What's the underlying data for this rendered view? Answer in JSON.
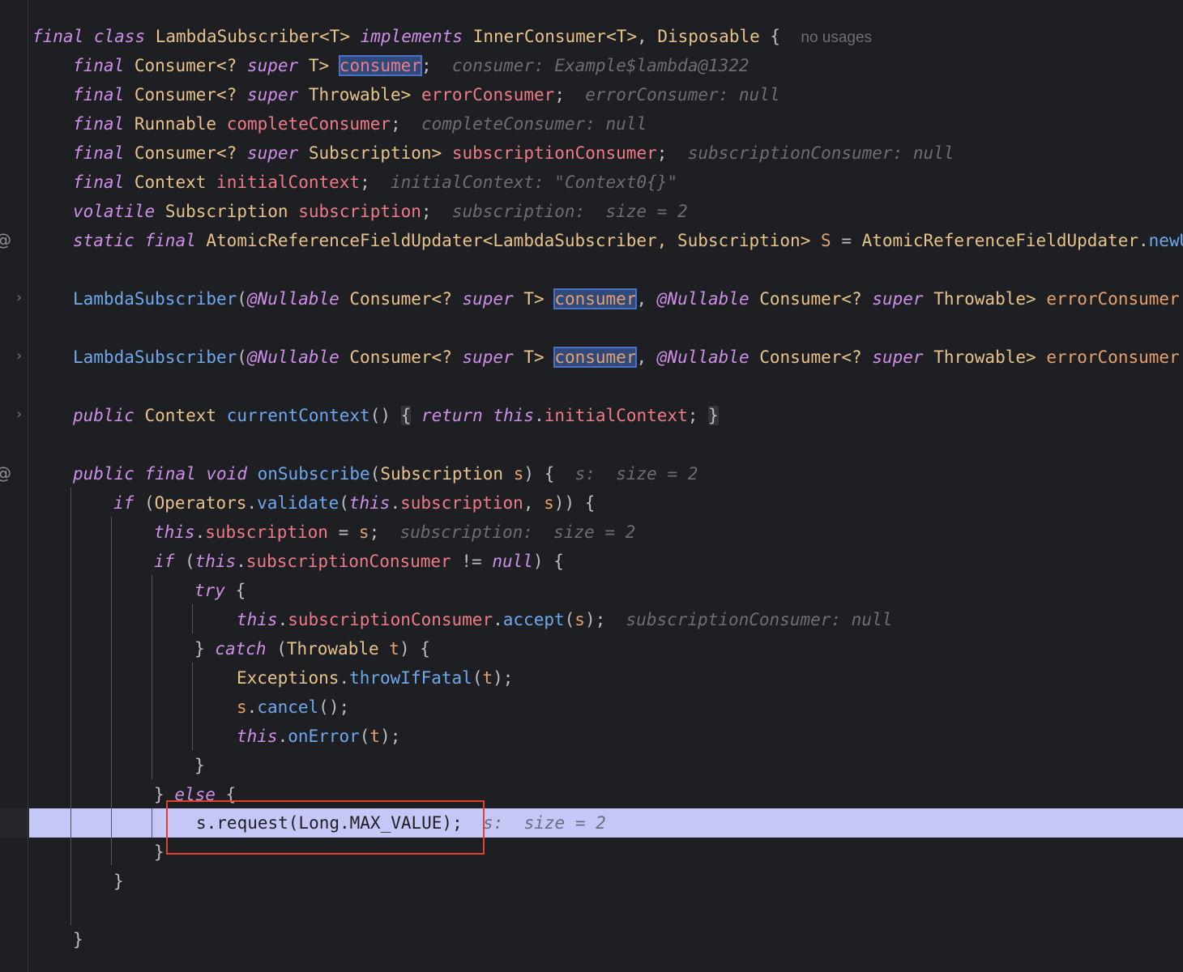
{
  "gutter": {
    "override_marker": "@",
    "fold_marker": "›"
  },
  "code": {
    "l01": {
      "kw_final": "final",
      "kw_class": "class",
      "class_name": "LambdaSubscriber<T>",
      "kw_implements": "implements",
      "iface1": "InnerConsumer<T>",
      "comma": ",",
      "iface2": "Disposable",
      "brace": "{",
      "hint": "no usages"
    },
    "l02": {
      "kw_final": "final",
      "t1": "Consumer<?",
      "kw_super": "super",
      "t2": "T>",
      "field": "consumer",
      "semi": ";",
      "hint": "consumer: Example$lambda@1322"
    },
    "l03": {
      "kw_final": "final",
      "t1": "Consumer<?",
      "kw_super": "super",
      "t2": "Throwable>",
      "field": "errorConsumer",
      "semi": ";",
      "hint": "errorConsumer: null"
    },
    "l04": {
      "kw_final": "final",
      "t1": "Runnable",
      "field": "completeConsumer",
      "semi": ";",
      "hint": "completeConsumer: null"
    },
    "l05": {
      "kw_final": "final",
      "t1": "Consumer<?",
      "kw_super": "super",
      "t2": "Subscription>",
      "field": "subscriptionConsumer",
      "semi": ";",
      "hint": "subscriptionConsumer: null"
    },
    "l06": {
      "kw_final": "final",
      "t1": "Context",
      "field": "initialContext",
      "semi": ";",
      "hint": "initialContext: \"Context0{}\""
    },
    "l07": {
      "kw_volatile": "volatile",
      "t1": "Subscription",
      "field": "subscription",
      "semi": ";",
      "hint": "subscription:  size = 2"
    },
    "l08": {
      "kw_static": "static",
      "kw_final": "final",
      "t1": "AtomicReferenceFieldUpdater<LambdaSubscriber, Subscription>",
      "field": "S",
      "eq": "=",
      "t2": "AtomicReferenceFieldUpdater",
      "dot": ".",
      "fn": "newU"
    },
    "l09": {
      "ctor": "LambdaSubscriber",
      "open": "(",
      "ann1": "@Nullable",
      "t1": "Consumer<?",
      "kw_super": "super",
      "t2": "T>",
      "param1": "consumer",
      "comma": ",",
      "ann2": "@Nullable",
      "t3": "Consumer<?",
      "kw_super2": "super",
      "t4": "Throwable>",
      "param2": "errorConsumer",
      "comma2": ","
    },
    "l10": {
      "ctor": "LambdaSubscriber",
      "open": "(",
      "ann1": "@Nullable",
      "t1": "Consumer<?",
      "kw_super": "super",
      "t2": "T>",
      "param1": "consumer",
      "comma": ",",
      "ann2": "@Nullable",
      "t3": "Consumer<?",
      "kw_super2": "super",
      "t4": "Throwable>",
      "param2": "errorConsumer",
      "comma2": ","
    },
    "l11": {
      "kw_public": "public",
      "t1": "Context",
      "fn": "currentContext",
      "parens": "()",
      "brace_open": "{",
      "kw_return": "return",
      "kw_this": "this",
      "dot": ".",
      "field": "initialContext",
      "semi": ";",
      "brace_close": "}"
    },
    "l12": {
      "kw_public": "public",
      "kw_final": "final",
      "kw_void": "void",
      "fn": "onSubscribe",
      "open": "(",
      "t1": "Subscription",
      "param": "s",
      "close": ")",
      "brace": "{",
      "hint": "s:  size = 2"
    },
    "l13": {
      "kw_if": "if",
      "open": "(",
      "t1": "Operators",
      "dot": ".",
      "fn": "validate",
      "open2": "(",
      "kw_this": "this",
      "dot2": ".",
      "field": "subscription",
      "comma": ",",
      "param": "s",
      "close": "))",
      "brace": "{"
    },
    "l14": {
      "kw_this": "this",
      "dot": ".",
      "field": "subscription",
      "eq": "=",
      "param": "s",
      "semi": ";",
      "hint": "subscription:  size = 2"
    },
    "l15": {
      "kw_if": "if",
      "open": "(",
      "kw_this": "this",
      "dot": ".",
      "field": "subscriptionConsumer",
      "op": "!=",
      "kw_null": "null",
      "close": ")",
      "brace": "{"
    },
    "l16": {
      "kw_try": "try",
      "brace": "{"
    },
    "l17": {
      "kw_this": "this",
      "dot": ".",
      "field": "subscriptionConsumer",
      "dot2": ".",
      "fn": "accept",
      "open": "(",
      "param": "s",
      "close": ");",
      "hint": "subscriptionConsumer: null"
    },
    "l18": {
      "brace_close": "}",
      "kw_catch": "catch",
      "open": "(",
      "t1": "Throwable",
      "param": "t",
      "close": ")",
      "brace": "{"
    },
    "l19": {
      "t1": "Exceptions",
      "dot": ".",
      "fn": "throwIfFatal",
      "open": "(",
      "param": "t",
      "close": ");"
    },
    "l20": {
      "param": "s",
      "dot": ".",
      "fn": "cancel",
      "close": "();"
    },
    "l21": {
      "kw_this": "this",
      "dot": ".",
      "fn": "onError",
      "open": "(",
      "param": "t",
      "close": ");"
    },
    "l22": {
      "brace": "}"
    },
    "l23": {
      "brace": "}",
      "kw_else": "else",
      "brace2": "{"
    },
    "l24": {
      "text": "s.request(Long.MAX_VALUE);",
      "hint": "s:  size = 2"
    },
    "l25": {
      "brace": "}"
    },
    "l26": {
      "brace": "}"
    },
    "l27": {
      "brace": "}"
    }
  }
}
